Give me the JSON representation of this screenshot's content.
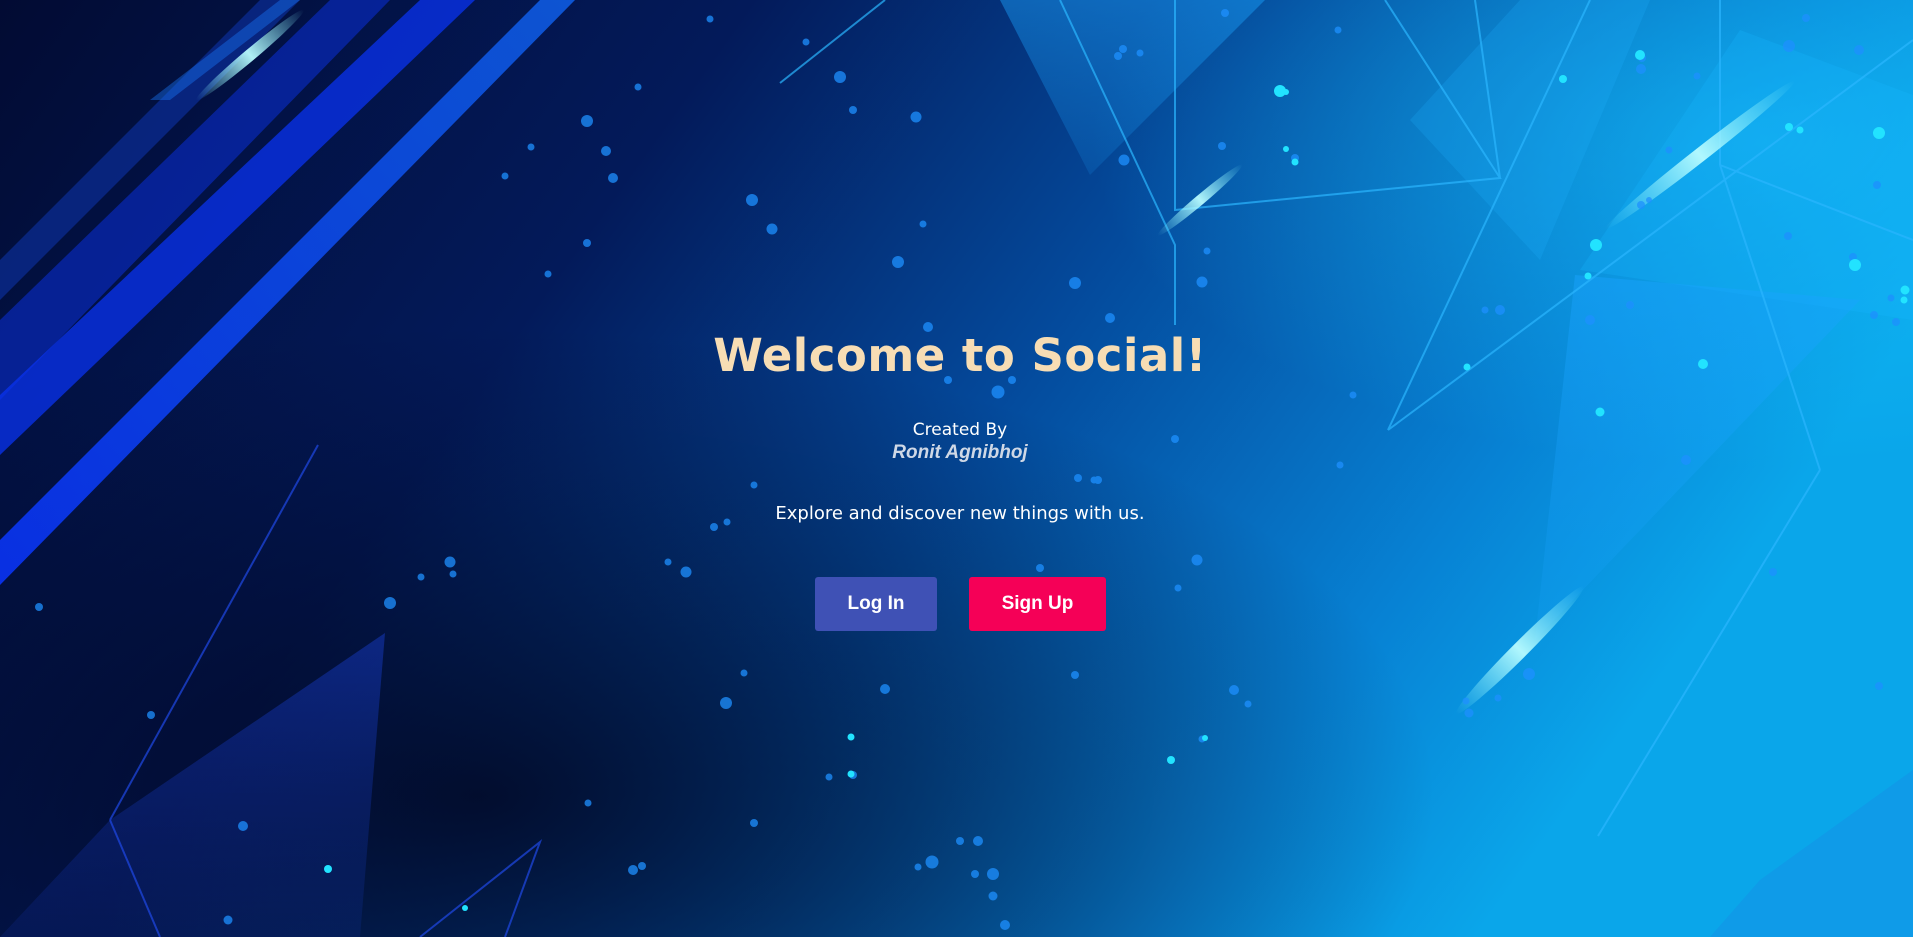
{
  "page": {
    "title": "Welcome to Social!",
    "created_by_label": "Created By",
    "author": "Ronit Agnibhoj",
    "tagline": "Explore and discover new things with us."
  },
  "buttons": {
    "login_label": "Log In",
    "signup_label": "Sign Up"
  },
  "colors": {
    "title": "#f7ddb4",
    "login_button": "#3f51b5",
    "signup_button": "#f50057",
    "background_dark": "#020a2e",
    "background_light": "#0a8de0"
  }
}
